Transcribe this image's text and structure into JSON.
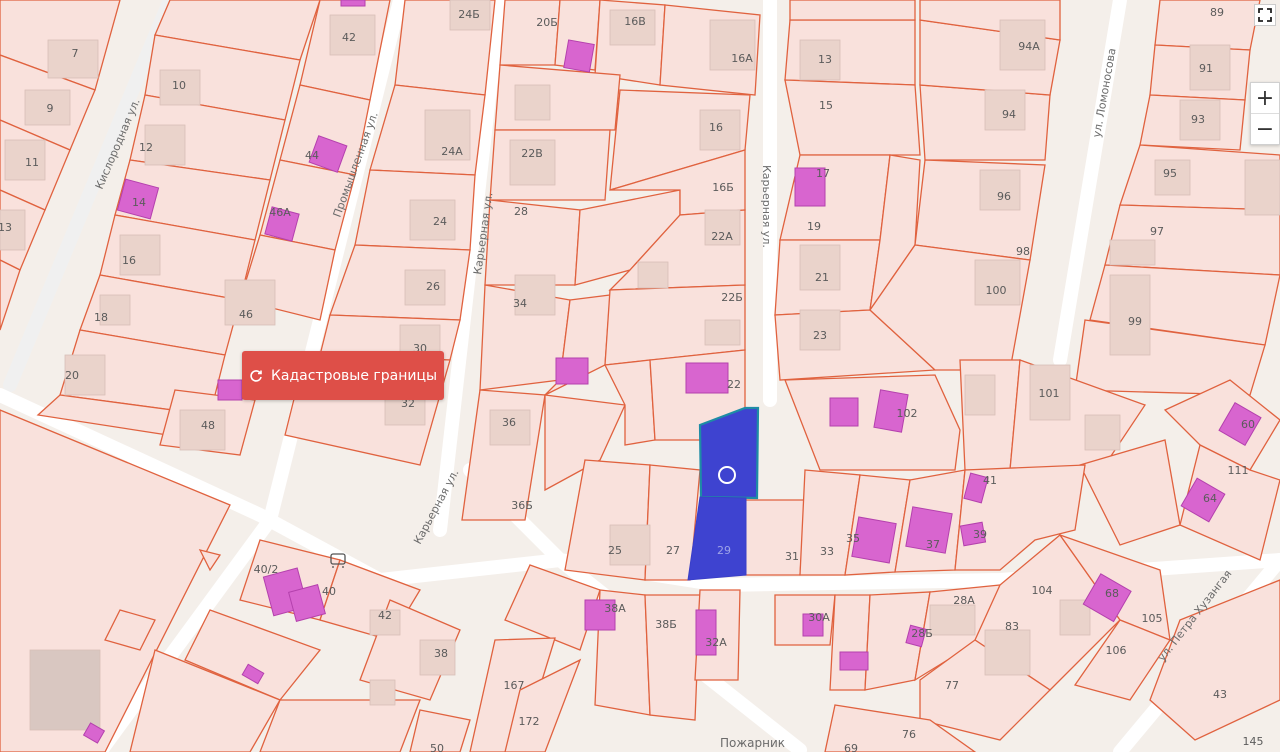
{
  "map": {
    "streets": {
      "kislorodnaya": "Кислородная ул.",
      "promyshlennaya": "Промышленная ул.",
      "karernaya_a": "Карьерная ул.",
      "karernaya_b": "Карьерная ул.",
      "karernaya_c": "Карьерная ул.",
      "lomonosova": "ул. Ломоносова",
      "khuzangaya": "ул. Петра Хузангая",
      "pozharnik": "Пожарник"
    },
    "parcels": {
      "p7": "7",
      "p9": "9",
      "p11": "11",
      "p13": "13",
      "p10": "10",
      "p12": "12",
      "p14": "14",
      "p16a": "16",
      "p18a": "18",
      "p20a": "20",
      "p42a": "42",
      "p24b": "24Б",
      "p44": "44",
      "p46a": "46А",
      "p46": "46",
      "p48": "48",
      "p24a": "24А",
      "p24": "24",
      "p26": "26",
      "p30": "30",
      "p32": "32",
      "p20b": "20Б",
      "p16v": "16В",
      "p16a_top": "16А",
      "p22v": "22В",
      "p28": "28",
      "p34": "34",
      "p36": "36",
      "p36b": "36Б",
      "p16": "16",
      "p16b": "16Б",
      "p22a": "22А",
      "p22b": "22Б",
      "p22": "22",
      "p13b": "13",
      "p15": "15",
      "p17": "17",
      "p19": "19",
      "p21": "21",
      "p23": "23",
      "p94a": "94А",
      "p94": "94",
      "p96": "96",
      "p98": "98",
      "p100": "100",
      "p89": "89",
      "p91": "91",
      "p93": "93",
      "p95": "95",
      "p97": "97",
      "p99": "99",
      "p101": "101",
      "p102": "102",
      "p41": "41",
      "p35": "35",
      "p37": "37",
      "p39": "39",
      "p33": "33",
      "p31": "31",
      "p29": "29",
      "p27": "27",
      "p25": "25",
      "p60": "60",
      "p111": "111",
      "p64": "64",
      "p38a": "38А",
      "p38b": "38Б",
      "p32a": "32А",
      "p30a": "30А",
      "p28b": "28Б",
      "p28a": "28А",
      "p104": "104",
      "p83": "83",
      "p68": "68",
      "p105": "105",
      "p106": "106",
      "p77": "77",
      "p76": "76",
      "p69": "69",
      "p43": "43",
      "p145": "145",
      "p167": "167",
      "p172": "172",
      "p40_2": "40/2",
      "p40": "40",
      "p42b": "42",
      "p38": "38",
      "p50": "50"
    }
  },
  "cadastre_button": {
    "label": "Кадастровые границы",
    "icon": "refresh-icon"
  },
  "zoom": {
    "plus": "+",
    "minus": "−"
  },
  "colors": {
    "parcel_fill": "#f9e1dc",
    "parcel_stroke": "#e0623f",
    "building": "#ead8d0",
    "selected": "#3e43d0",
    "highlight": "#d865cf"
  }
}
